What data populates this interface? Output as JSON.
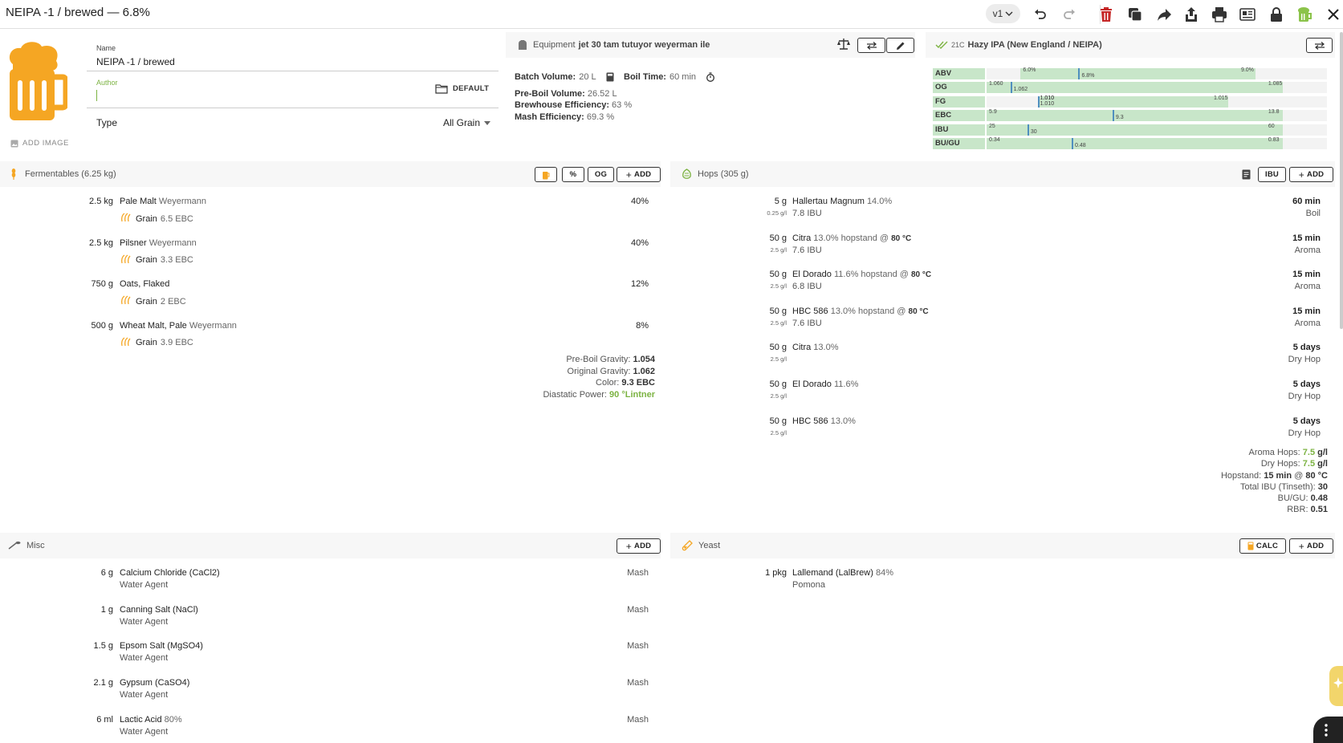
{
  "header": {
    "title": "NEIPA -1 / brewed — 6.8%",
    "version": "v1"
  },
  "recipe": {
    "name_label": "Name",
    "name_value": "NEIPA -1  / brewed",
    "author_label": "Author",
    "default_label": "DEFAULT",
    "type_label": "Type",
    "type_value": "All Grain",
    "add_image_label": "ADD IMAGE"
  },
  "equipment": {
    "prefix": "Equipment",
    "name": "jet 30 tam tutuyor weyerman ile",
    "batch_volume_label": "Batch Volume:",
    "batch_volume": "20 L",
    "boil_time_label": "Boil Time:",
    "boil_time": "60 min",
    "preboil_label": "Pre-Boil Volume:",
    "preboil": "26.52 L",
    "brewhouse_label": "Brewhouse Efficiency:",
    "brewhouse": "63 %",
    "mash_label": "Mash Efficiency:",
    "mash": "69.3 %"
  },
  "style": {
    "code": "21C",
    "name": "Hazy IPA (New England / NEIPA)",
    "bars": [
      {
        "label": "ABV",
        "min": "6.0%",
        "max": "9.0%",
        "value": "6.8%",
        "range": [
          0.1,
          0.79
        ],
        "mark": 0.27
      },
      {
        "label": "OG",
        "min": "1.060",
        "max": "1.085",
        "value": "1.062",
        "range": [
          0.0,
          0.87
        ],
        "mark": 0.07
      },
      {
        "label": "FG",
        "min": "1.010",
        "value_lines": [
          "1.010",
          "1.010"
        ],
        "max": "1.015",
        "range": [
          0.15,
          0.71
        ],
        "mark": 0.15
      },
      {
        "label": "EBC",
        "min": "5.9",
        "max": "13.8",
        "value": "9.3",
        "range": [
          0.0,
          0.87
        ],
        "mark": 0.37
      },
      {
        "label": "IBU",
        "min": "25",
        "max": "60",
        "value": "30",
        "range": [
          0.0,
          0.87
        ],
        "mark": 0.12
      },
      {
        "label": "BU/GU",
        "min": "0.34",
        "max": "0.83",
        "value": "0.48",
        "range": [
          0.0,
          0.87
        ],
        "mark": 0.25
      }
    ]
  },
  "fermentables": {
    "title": "Fermentables (6.25 kg)",
    "pct_btn": "%",
    "og_btn": "OG",
    "add_btn": "ADD",
    "items": [
      {
        "amount": "2.5 kg",
        "name": "Pale Malt",
        "supplier": "Weyermann",
        "type": "Grain",
        "color": "6.5 EBC",
        "pct": "40%"
      },
      {
        "amount": "2.5 kg",
        "name": "Pilsner",
        "supplier": "Weyermann",
        "type": "Grain",
        "color": "3.3 EBC",
        "pct": "40%"
      },
      {
        "amount": "750 g",
        "name": "Oats, Flaked",
        "supplier": "",
        "type": "Grain",
        "color": "2 EBC",
        "pct": "12%"
      },
      {
        "amount": "500 g",
        "name": "Wheat Malt, Pale",
        "supplier": "Weyermann",
        "type": "Grain",
        "color": "3.9 EBC",
        "pct": "8%"
      }
    ],
    "summary": {
      "preboil_label": "Pre-Boil Gravity:",
      "preboil": "1.054",
      "og_label": "Original Gravity:",
      "og": "1.062",
      "color_label": "Color:",
      "color": "9.3 EBC",
      "dp_label": "Diastatic Power:",
      "dp": "90 °Lintner"
    }
  },
  "hops": {
    "title": "Hops (305 g)",
    "ibu_btn": "IBU",
    "add_btn": "ADD",
    "items": [
      {
        "amount": "5 g",
        "rate": "0.25 g/l",
        "name": "Hallertau Magnum",
        "alpha": "14.0%",
        "extra": "",
        "extra_temp": "",
        "ibu": "7.8 IBU",
        "time": "60 min",
        "use": "Boil"
      },
      {
        "amount": "50 g",
        "rate": "2.5 g/l",
        "name": "Citra",
        "alpha": "13.0%",
        "extra": "hopstand @",
        "extra_temp": "80 °C",
        "ibu": "7.6 IBU",
        "time": "15 min",
        "use": "Aroma"
      },
      {
        "amount": "50 g",
        "rate": "2.5 g/l",
        "name": "El Dorado",
        "alpha": "11.6%",
        "extra": "hopstand @",
        "extra_temp": "80 °C",
        "ibu": "6.8 IBU",
        "time": "15 min",
        "use": "Aroma"
      },
      {
        "amount": "50 g",
        "rate": "2.5 g/l",
        "name": "HBC 586",
        "alpha": "13.0%",
        "extra": "hopstand @",
        "extra_temp": "80 °C",
        "ibu": "7.6 IBU",
        "time": "15 min",
        "use": "Aroma"
      },
      {
        "amount": "50 g",
        "rate": "2.5 g/l",
        "name": "Citra",
        "alpha": "13.0%",
        "extra": "",
        "extra_temp": "",
        "ibu": "",
        "time": "5 days",
        "use": "Dry Hop"
      },
      {
        "amount": "50 g",
        "rate": "2.5 g/l",
        "name": "El Dorado",
        "alpha": "11.6%",
        "extra": "",
        "extra_temp": "",
        "ibu": "",
        "time": "5 days",
        "use": "Dry Hop"
      },
      {
        "amount": "50 g",
        "rate": "2.5 g/l",
        "name": "HBC 586",
        "alpha": "13.0%",
        "extra": "",
        "extra_temp": "",
        "ibu": "",
        "time": "5 days",
        "use": "Dry Hop"
      }
    ],
    "summary": {
      "aroma_label": "Aroma Hops:",
      "aroma": "7.5",
      "aroma_unit": "g/l",
      "dry_label": "Dry Hops:",
      "dry": "7.5",
      "dry_unit": "g/l",
      "hopstand_label": "Hopstand:",
      "hopstand_time": "15 min",
      "hopstand_at": "@",
      "hopstand_temp": "80 °C",
      "ibu_label": "Total IBU (Tinseth):",
      "ibu": "30",
      "bugu_label": "BU/GU:",
      "bugu": "0.48",
      "rbr_label": "RBR:",
      "rbr": "0.51"
    }
  },
  "misc": {
    "title": "Misc",
    "add_btn": "ADD",
    "items": [
      {
        "amount": "6 g",
        "name": "Calcium Chloride (CaCl2)",
        "extra": "",
        "type": "Water Agent",
        "use": "Mash"
      },
      {
        "amount": "1 g",
        "name": "Canning Salt (NaCl)",
        "extra": "",
        "type": "Water Agent",
        "use": "Mash"
      },
      {
        "amount": "1.5 g",
        "name": "Epsom Salt (MgSO4)",
        "extra": "",
        "type": "Water Agent",
        "use": "Mash"
      },
      {
        "amount": "2.1 g",
        "name": "Gypsum (CaSO4)",
        "extra": "",
        "type": "Water Agent",
        "use": "Mash"
      },
      {
        "amount": "6 ml",
        "name": "Lactic Acid",
        "extra": "80%",
        "type": "Water Agent",
        "use": "Mash"
      }
    ]
  },
  "yeast": {
    "title": "Yeast",
    "calc_btn": "CALC",
    "add_btn": "ADD",
    "items": [
      {
        "amount": "1 pkg",
        "name": "Lallemand (LalBrew)",
        "attenuation": "84%",
        "strain": "Pomona"
      }
    ]
  },
  "colors": {
    "accent_orange": "#f5a623",
    "green": "#7cb342",
    "style_green": "#c8e6c9",
    "delete_red": "#c62828"
  }
}
